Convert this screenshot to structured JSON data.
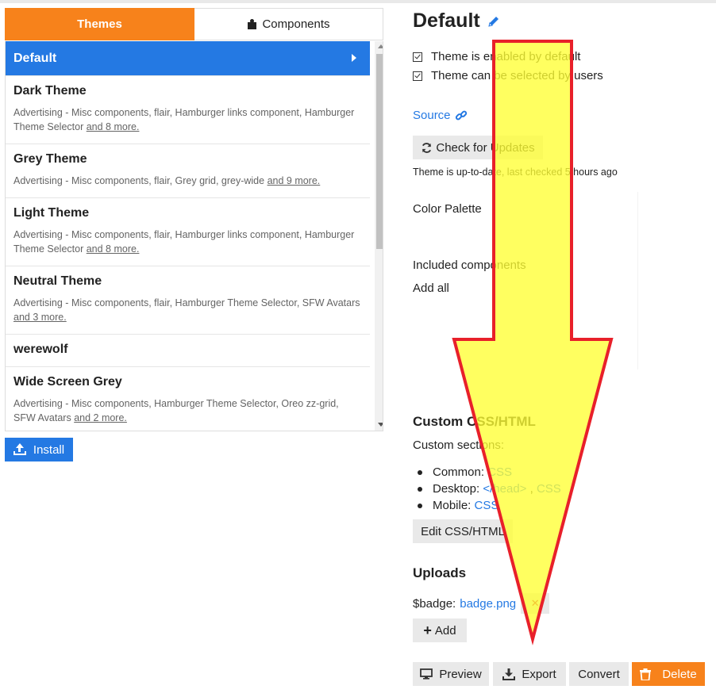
{
  "tabs": {
    "themes": "Themes",
    "components": "Components"
  },
  "themes": [
    {
      "name": "Default",
      "active": true
    },
    {
      "name": "Dark Theme",
      "desc": "Advertising - Misc components, flair, Hamburger links component, Hamburger Theme Selector ",
      "more": "and 8 more."
    },
    {
      "name": "Grey Theme",
      "desc": "Advertising - Misc components, flair, Grey grid, grey-wide ",
      "more": "and 9 more."
    },
    {
      "name": "Light Theme",
      "desc": "Advertising - Misc components, flair, Hamburger links component, Hamburger Theme Selector ",
      "more": "and 8 more."
    },
    {
      "name": "Neutral Theme",
      "desc": "Advertising - Misc components, flair, Hamburger Theme Selector, SFW Avatars ",
      "more": "and 3 more."
    },
    {
      "name": "werewolf"
    },
    {
      "name": "Wide Screen Grey",
      "desc": "Advertising - Misc components, Hamburger Theme Selector, Oreo zz-grid, SFW Avatars ",
      "more": "and 2 more."
    }
  ],
  "install_label": "Install",
  "detail": {
    "title": "Default",
    "checks": [
      "Theme is enabled by default",
      "Theme can be selected by users"
    ],
    "source_label": "Source",
    "check_updates_label": "Check for Updates",
    "status": "Theme is up-to-date, last checked 5 hours ago",
    "color_palette_label": "Color Palette",
    "included_components_label": "Included components",
    "add_all_label": "Add all",
    "custom_heading": "Custom CSS/HTML",
    "custom_sections_label": "Custom sections:",
    "sections": {
      "common_label": "Common:",
      "common_css": "CSS",
      "desktop_label": "Desktop:",
      "desktop_head": "</head>",
      "desktop_sep": ",",
      "desktop_css": "CSS",
      "mobile_label": "Mobile:",
      "mobile_css": "CSS"
    },
    "edit_label": "Edit CSS/HTML",
    "uploads_heading": "Uploads",
    "upload_var": "$badge:",
    "upload_file": "badge.png",
    "remove_symbol": "✕",
    "add_label": "Add"
  },
  "actions": {
    "preview": "Preview",
    "export": "Export",
    "convert": "Convert",
    "delete": "Delete"
  },
  "colors": {
    "accent": "#f7821b",
    "primary": "#2479e3",
    "overlay_fill": "#ffff33",
    "overlay_stroke": "#e8202a"
  }
}
